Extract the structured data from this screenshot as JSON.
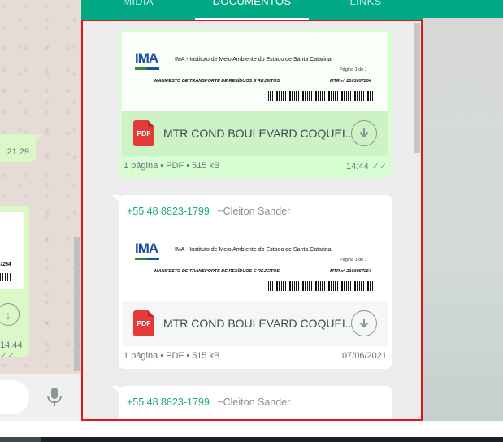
{
  "tabs": [
    {
      "label": "MÍDIA"
    },
    {
      "label": "DOCUMENTOS"
    },
    {
      "label": "LINKS"
    }
  ],
  "chat": {
    "bubble_time": "21:29",
    "doc_time": "14:44"
  },
  "cards": [
    {
      "kind": "sent",
      "doc_preview": {
        "institution": "IMA - Instituto de Meio Ambiente do Estado de Santa Catarina",
        "page": "Página 1 de 1",
        "title": "MANIFESTO DE TRANSPORTE DE RESÍDUOS E REJEITOS",
        "mtr": "MTR nº 2103057254"
      },
      "file_name": "MTR COND BOULEVARD COQUEI...",
      "meta": "1 página • PDF • 515 kB",
      "time": "14:44"
    },
    {
      "kind": "received",
      "sender_number": "+55 48 8823-1799",
      "sender_name": "~Cleiton Sander",
      "doc_preview": {
        "institution": "IMA - Instituto de Meio Ambiente do Estado de Santa Catarina",
        "page": "Página 1 de 1",
        "title": "MANIFESTO DE TRANSPORTE DE RESÍDUOS E REJEITOS",
        "mtr": "MTR nº 2103057254"
      },
      "file_name": "MTR COND BOULEVARD COQUEI...",
      "meta": "1 página • PDF • 515 kB",
      "time": "07/06/2021"
    },
    {
      "kind": "received",
      "sender_number": "+55 48 8823-1799",
      "sender_name": "~Cleiton Sander"
    }
  ],
  "logo_text": "IMA",
  "pdf_badge": "PDF",
  "colors": {
    "accent": "#00a884",
    "sent_bubble": "#d9fdd3",
    "highlight_border": "#e4141b",
    "pdf_red": "#e5393a"
  }
}
